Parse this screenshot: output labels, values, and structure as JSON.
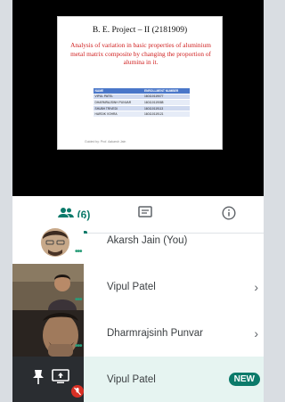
{
  "slide": {
    "title": "B. E. Project – II (2181909)",
    "subtitle": "Analysis of variation in basic properties of aluminium metal matrix composite by changing the proportion of alumina in it.",
    "table": {
      "headers": [
        "NAME",
        "ENROLLMENT NUMBER"
      ],
      "rows": [
        [
          "VIPUL PATEL",
          "160110119077"
        ],
        [
          "DHARMRAJSINH PUNVAR",
          "160110119088"
        ],
        [
          "SHUBH TRIVEDI",
          "160110119113"
        ],
        [
          "HARDIK VOHRA",
          "160110119121"
        ]
      ]
    },
    "guide": "Guided by: Prof. Aakarsh Jain"
  },
  "tabs": {
    "people_count": "(6)"
  },
  "participants": [
    {
      "name": "Akarsh Jain (You)"
    },
    {
      "name": "Vipul Patel"
    },
    {
      "name": "Dharmrajsinh Punvar"
    },
    {
      "name": "Vipul Patel",
      "badge": "NEW"
    }
  ],
  "colors": {
    "accent": "#0b7a6a",
    "slide_subtitle": "#d02020",
    "table_header": "#4a77c9"
  }
}
